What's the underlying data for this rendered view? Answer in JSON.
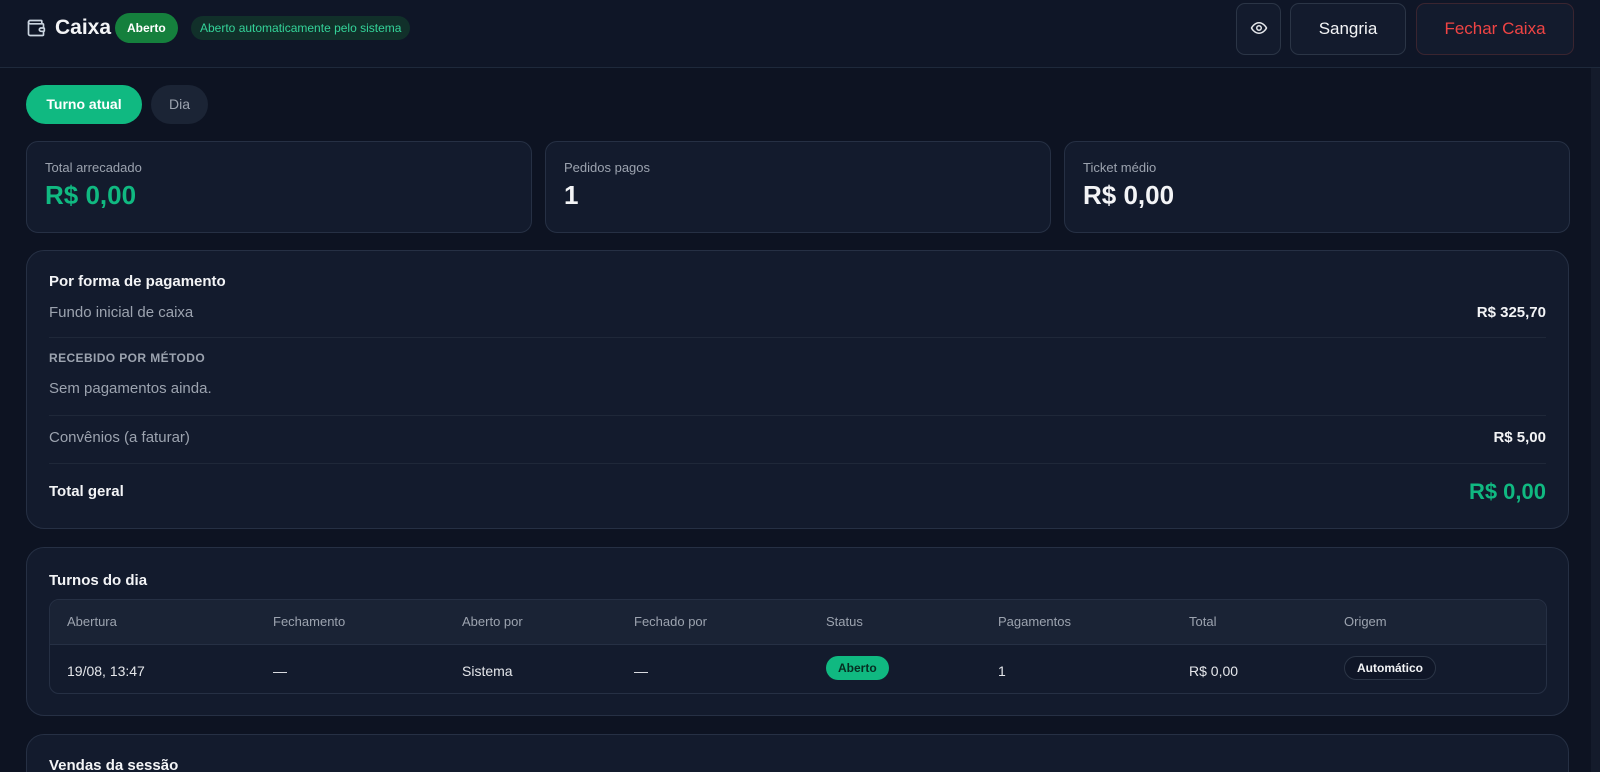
{
  "header": {
    "title": "Caixa",
    "status_badge": "Aberto",
    "auto_badge": "Aberto automaticamente pelo sistema",
    "sangria_label": "Sangria",
    "close_label": "Fechar Caixa"
  },
  "tabs": [
    {
      "label": "Turno atual",
      "active": true
    },
    {
      "label": "Dia",
      "active": false
    }
  ],
  "stats": [
    {
      "label": "Total arrecadado",
      "value": "R$ 0,00"
    },
    {
      "label": "Pedidos pagos",
      "value": "1"
    },
    {
      "label": "Ticket médio",
      "value": "R$ 0,00"
    }
  ],
  "payment": {
    "title": "Por forma de pagamento",
    "initial_fund_label": "Fundo inicial de caixa",
    "initial_fund_value": "R$ 325,70",
    "method_heading": "RECEBIDO POR MÉTODO",
    "empty_text": "Sem pagamentos ainda.",
    "agreements_label": "Convênios (a faturar)",
    "agreements_value": "R$ 5,00",
    "total_label": "Total geral",
    "total_value": "R$ 0,00"
  },
  "shifts": {
    "title": "Turnos do dia",
    "columns": [
      "Abertura",
      "Fechamento",
      "Aberto por",
      "Fechado por",
      "Status",
      "Pagamentos",
      "Total",
      "Origem"
    ],
    "rows": [
      {
        "opening": "19/08, 13:47",
        "closing": "—",
        "opened_by": "Sistema",
        "closed_by": "—",
        "status": "Aberto",
        "payments": "1",
        "total": "R$ 0,00",
        "origin": "Automático"
      }
    ]
  },
  "sales": {
    "title": "Vendas da sessão"
  },
  "colors": {
    "accent": "#10b981",
    "danger": "#ef4444",
    "background": "#0d1322"
  }
}
